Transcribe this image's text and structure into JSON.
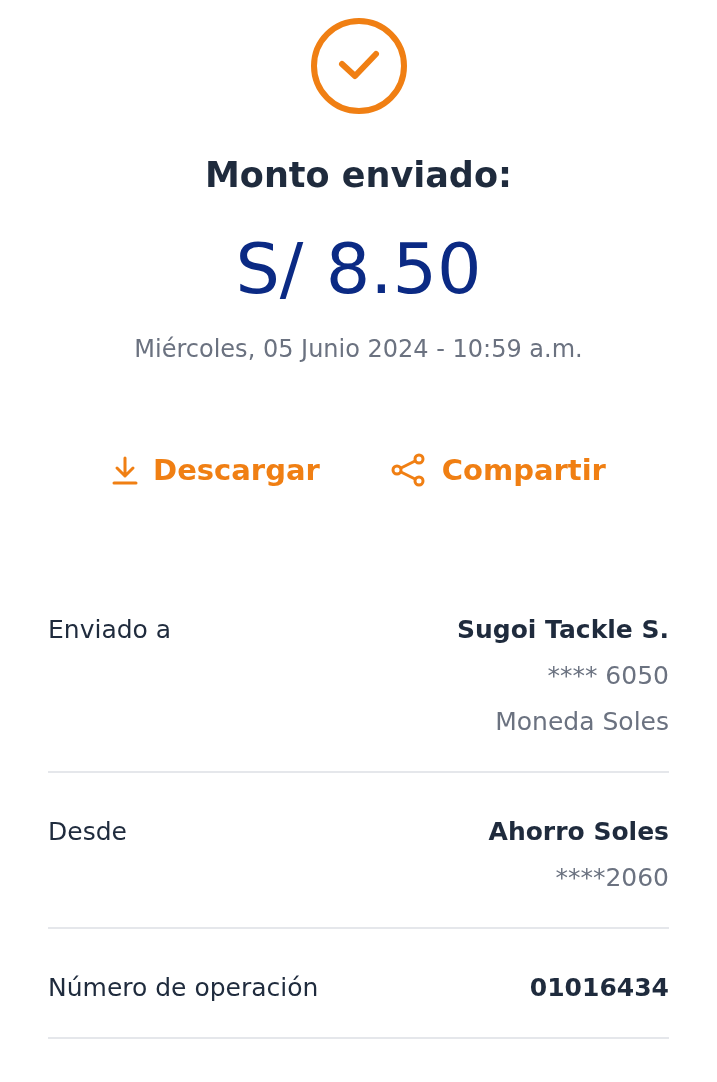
{
  "title": "Monto enviado:",
  "amount": "S/ 8.50",
  "date": "Miércoles, 05 Junio 2024 - 10:59 a.m.",
  "actions": [
    {
      "kind": "download",
      "label": "Descargar"
    },
    {
      "kind": "share",
      "label": "Compartir"
    }
  ],
  "details": [
    {
      "label": "Enviado a",
      "value": "Sugoi Tackle S.",
      "lines": [
        "**** 6050",
        "Moneda Soles"
      ]
    },
    {
      "label": "Desde",
      "value": "Ahorro Soles",
      "lines": [
        "****2060"
      ]
    },
    {
      "label": "Número de operación",
      "value": "01016434"
    }
  ]
}
